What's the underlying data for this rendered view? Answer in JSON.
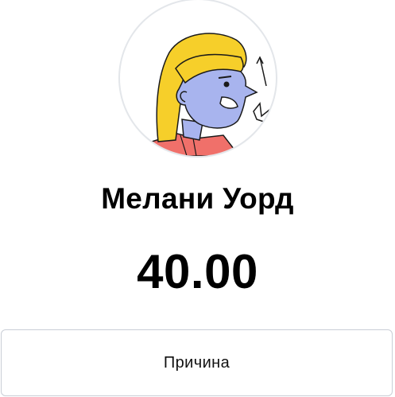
{
  "profile": {
    "name": "Мелани Уорд",
    "avatar_icon": "person-illustration-avatar",
    "avatar_colors": {
      "hair": "#f6cf2a",
      "skin": "#a8b4ee",
      "shirt": "#f0706a",
      "line": "#1a1a1a"
    }
  },
  "amount": {
    "value": "40.00"
  },
  "reason_button": {
    "label": "Причина"
  }
}
